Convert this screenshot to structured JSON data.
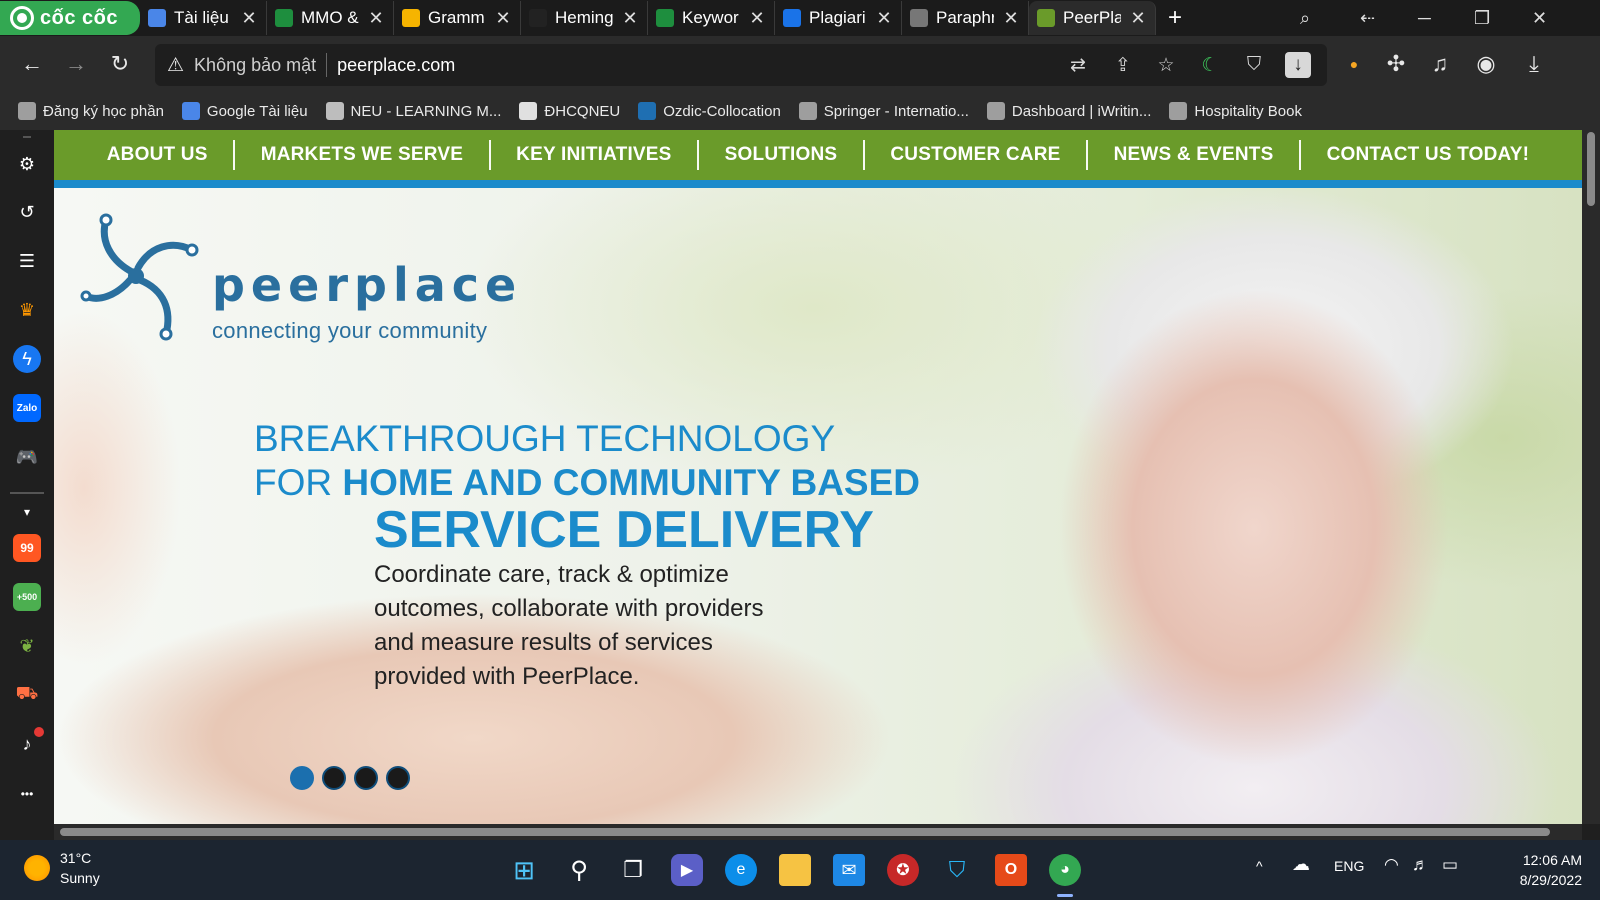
{
  "browser": {
    "brand": "cốc cốc",
    "tabs": [
      {
        "title": "Tài liệu",
        "favicon_color": "#4a86e8"
      },
      {
        "title": "MMO &",
        "favicon_color": "#1e8e3e"
      },
      {
        "title": "Gramm",
        "favicon_color": "#f6b400"
      },
      {
        "title": "Heming",
        "favicon_color": "#222222"
      },
      {
        "title": "Keywor",
        "favicon_color": "#1e8e3e"
      },
      {
        "title": "Plagiari",
        "favicon_color": "#1a73e8"
      },
      {
        "title": "Paraphr",
        "favicon_color": "#777777"
      },
      {
        "title": "PeerPla",
        "favicon_color": "#6a9b2a",
        "active": true
      }
    ],
    "close_glyph": "✕",
    "new_tab_glyph": "+",
    "window_controls": {
      "minimize": "─",
      "maximize": "❐",
      "close": "✕"
    },
    "toolbar": {
      "back": "←",
      "forward": "→",
      "reload": "↻",
      "security_label": "Không bảo mật",
      "url": "peerplace.com"
    },
    "bookmarks": [
      {
        "label": "Đăng ký học phần",
        "color": "#9e9e9e"
      },
      {
        "label": "Google Tài liệu",
        "color": "#4a86e8"
      },
      {
        "label": "NEU - LEARNING M...",
        "color": "#bdbdbd"
      },
      {
        "label": "ĐHCQNEU",
        "color": "#e0e0e0"
      },
      {
        "label": "Ozdic-Collocation",
        "color": "#1f6fb2"
      },
      {
        "label": "Springer - Internatio...",
        "color": "#9e9e9e"
      },
      {
        "label": "Dashboard | iWritin...",
        "color": "#9e9e9e"
      },
      {
        "label": "Hospitality Book",
        "color": "#9e9e9e"
      }
    ]
  },
  "sidepanel": {
    "icons": [
      "gear-icon",
      "history-icon",
      "list-icon",
      "crown-icon",
      "messenger-icon",
      "zalo-icon",
      "gamepad-icon",
      "chevron-down-icon",
      "shopping-99-icon",
      "reward-500-icon",
      "leaf-icon",
      "cart-icon",
      "bell-icon",
      "more-icon"
    ],
    "zalo_label": "Zalo",
    "badge_99": "99",
    "badge_500": "+500",
    "more_glyph": "•••"
  },
  "site": {
    "nav": [
      "ABOUT US",
      "MARKETS WE SERVE",
      "KEY INITIATIVES",
      "SOLUTIONS",
      "CUSTOMER CARE",
      "NEWS & EVENTS",
      "CONTACT US TODAY!"
    ],
    "accent_green": "#6a9b2a",
    "accent_blue": "#1b8bcb",
    "logo_name": "peerplace",
    "logo_tagline": "connecting your community",
    "headline_line1": "BREAKTHROUGH TECHNOLOGY",
    "headline_line2_light": "FOR ",
    "headline_line2_bold": "HOME AND COMMUNITY BASED",
    "headline_line3": "SERVICE DELIVERY",
    "description": "Coordinate care, track & optimize outcomes, collaborate with providers and measure results of services provided with PeerPlace.",
    "slider_dots": 4,
    "slider_active_index": 0
  },
  "taskbar": {
    "weather_temp": "31°C",
    "weather_desc": "Sunny",
    "apps": [
      "windows-start-icon",
      "search-icon",
      "task-view-icon",
      "chat-icon",
      "edge-icon",
      "file-explorer-icon",
      "mail-icon",
      "game-icon",
      "defender-icon",
      "office-icon",
      "coccoc-icon"
    ],
    "tray_caret": "^",
    "language": "ENG",
    "time": "12:06 AM",
    "date": "8/29/2022"
  }
}
